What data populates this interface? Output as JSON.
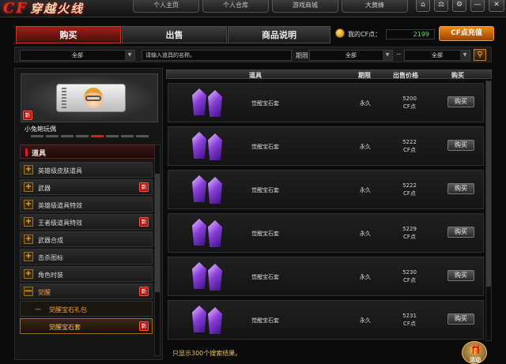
{
  "app": {
    "logo_mark": "CF",
    "logo_text": "穿越火线"
  },
  "top_nav": [
    "个人主页",
    "个人仓库",
    "游戏商城",
    "大黄蜂"
  ],
  "window_controls": [
    "⌂",
    "⚖",
    "⚙",
    "—",
    "✕"
  ],
  "tabs": [
    {
      "label": "购买",
      "active": true
    },
    {
      "label": "出售",
      "active": false
    },
    {
      "label": "商品说明",
      "active": false
    }
  ],
  "account": {
    "cf_label": "我的CF点：",
    "cf_points": "2199",
    "recharge_label": "CF点充值"
  },
  "filters": {
    "category": "全部",
    "search_placeholder": "请输入道具的名称。",
    "period_label": "期限",
    "range_from": "全部",
    "range_sep": "~",
    "range_to": "全部"
  },
  "preview": {
    "new_badge": "新",
    "item_name": "小兔鲍玩偶"
  },
  "categories": {
    "header": "道具",
    "items": [
      {
        "label": "英雄级皮肤道具",
        "new": false
      },
      {
        "label": "武器",
        "new": true
      },
      {
        "label": "英雄级道具特效",
        "new": false
      },
      {
        "label": "王者级道具特效",
        "new": true
      },
      {
        "label": "武器合成",
        "new": false
      },
      {
        "label": "击杀图标",
        "new": false
      },
      {
        "label": "角色时装",
        "new": false
      },
      {
        "label": "觉醒",
        "new": true,
        "expanded": true,
        "expand_glyph": "—"
      },
      {
        "label": "觉醒宝石礼包",
        "new": false,
        "sub": true,
        "dash": "—"
      },
      {
        "label": "觉醒宝石套",
        "new": true,
        "sub": true,
        "selected": true
      }
    ],
    "new_badge": "新",
    "plus_glyph": "+"
  },
  "table": {
    "headers": {
      "name": "道具",
      "period": "期限",
      "price": "出售价格",
      "buy": "购买"
    },
    "rows": [
      {
        "name": "觉醒宝石套",
        "period": "永久",
        "price": "5200",
        "unit": "CF点",
        "buy": "购买"
      },
      {
        "name": "觉醒宝石套",
        "period": "永久",
        "price": "5222",
        "unit": "CF点",
        "buy": "购买"
      },
      {
        "name": "觉醒宝石套",
        "period": "永久",
        "price": "5222",
        "unit": "CF点",
        "buy": "购买"
      },
      {
        "name": "觉醒宝石套",
        "period": "永久",
        "price": "5229",
        "unit": "CF点",
        "buy": "购买"
      },
      {
        "name": "觉醒宝石套",
        "period": "永久",
        "price": "5230",
        "unit": "CF点",
        "buy": "购买"
      },
      {
        "name": "觉醒宝石套",
        "period": "永久",
        "price": "5231",
        "unit": "CF点",
        "buy": "购买"
      }
    ]
  },
  "footer": {
    "note": "只显示300个搜索结果。",
    "event_label": "活动",
    "event_icon": "gift-icon"
  },
  "colors": {
    "accent_red": "#c0392b",
    "accent_orange": "#f08a18",
    "cf_points": "#6bd06b",
    "highlight": "#f0a040"
  }
}
